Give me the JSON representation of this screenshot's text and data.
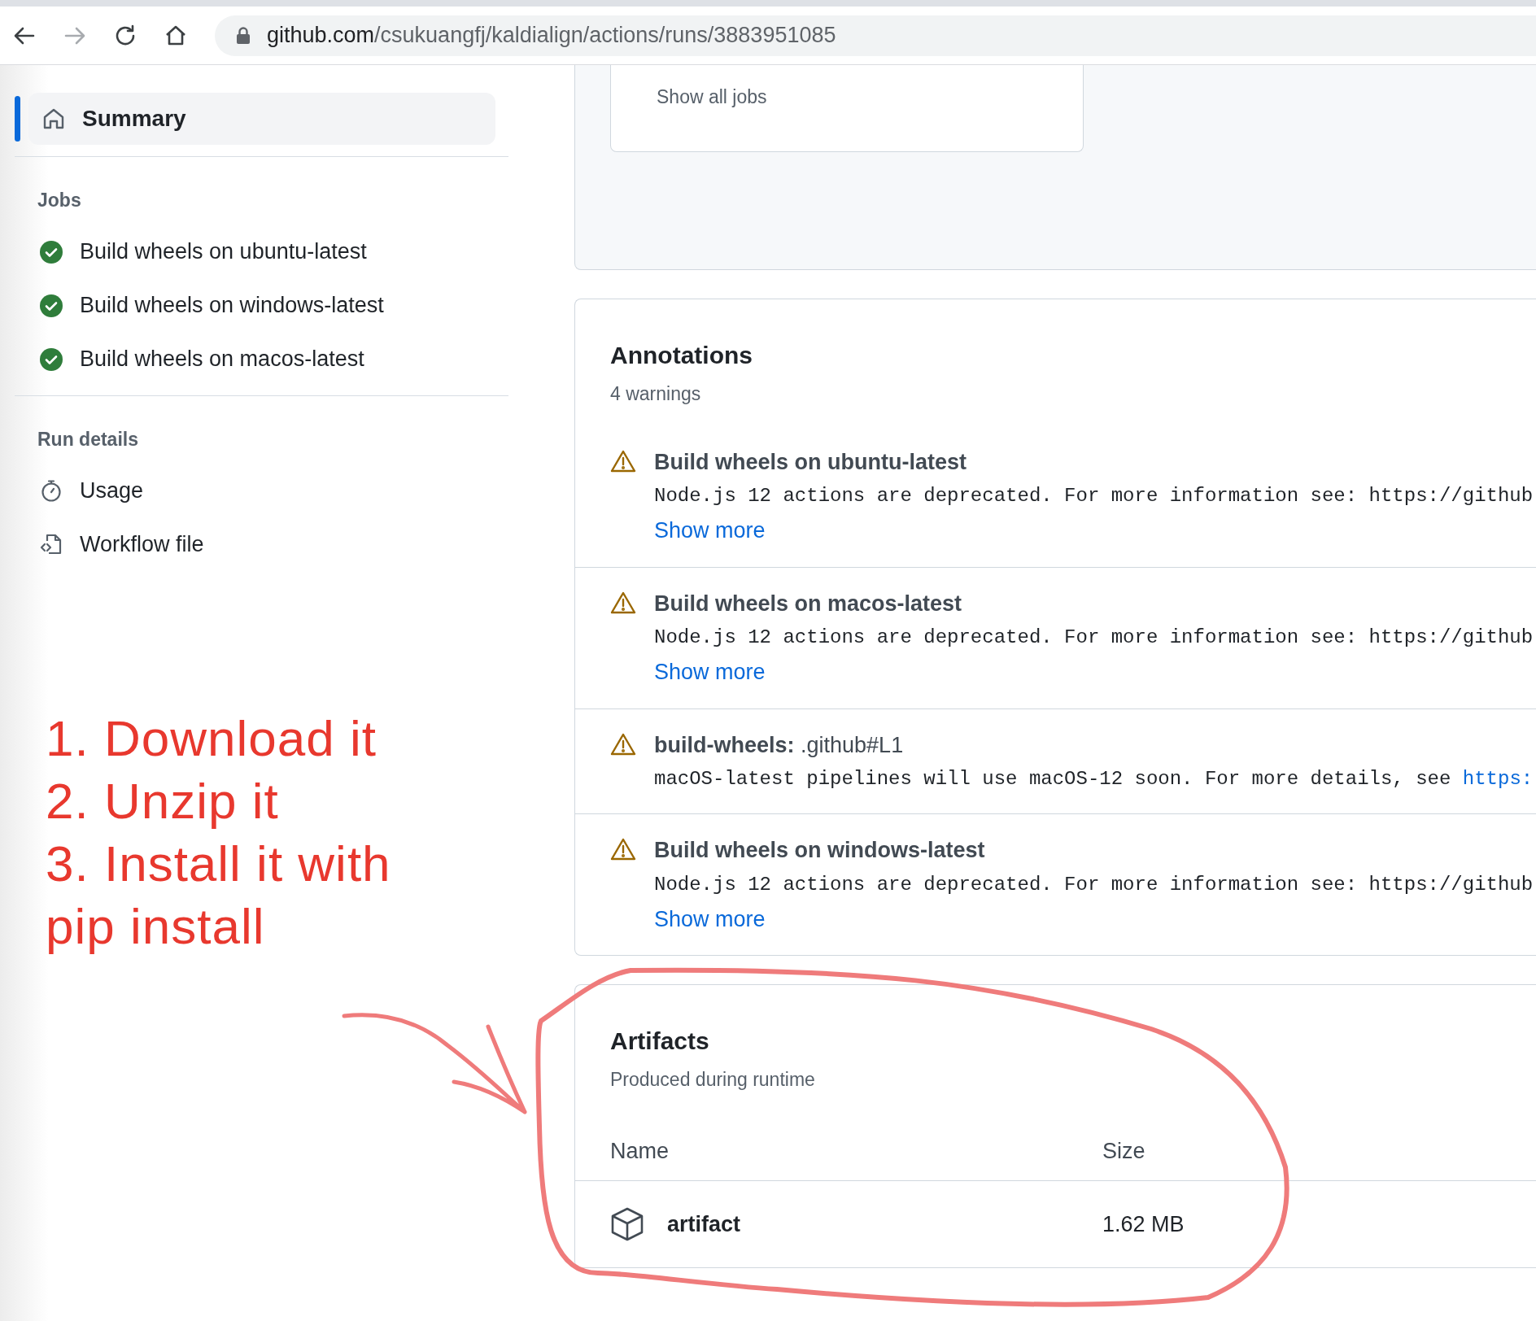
{
  "browser": {
    "forward_disabled": true,
    "url_host": "github.com",
    "url_path": "/csukuangfj/kaldialign/actions/runs/3883951085"
  },
  "sidebar": {
    "summary": {
      "label": "Summary",
      "selected": true
    },
    "sections": [
      {
        "title": "Jobs",
        "items": [
          {
            "kind": "job",
            "succeeded": true,
            "label": "Build wheels on ubuntu-latest"
          },
          {
            "kind": "job",
            "succeeded": true,
            "label": "Build wheels on windows-latest"
          },
          {
            "kind": "job",
            "succeeded": true,
            "label": "Build wheels on macos-latest"
          }
        ]
      },
      {
        "title": "Run details",
        "items": [
          {
            "kind": "usage",
            "label": "Usage"
          },
          {
            "kind": "workflow",
            "label": "Workflow file"
          }
        ]
      }
    ]
  },
  "jobs_card": {
    "link": "Show all jobs"
  },
  "annotations": {
    "title": "Annotations",
    "subtitle": "4 warnings",
    "items": [
      {
        "title": "Build wheels on ubuntu-latest",
        "message": "Node.js 12 actions are deprecated. For more information see: https://github",
        "more": "Show more"
      },
      {
        "title": "Build wheels on macos-latest",
        "message": "Node.js 12 actions are deprecated. For more information see: https://github",
        "more": "Show more"
      },
      {
        "title": "build-wheels:",
        "location": ".github#L1",
        "message": "macOS-latest pipelines will use macOS-12 soon. For more details, see ",
        "message_link": "https:"
      },
      {
        "title": "Build wheels on windows-latest",
        "message": "Node.js 12 actions are deprecated. For more information see: https://github",
        "more": "Show more"
      }
    ]
  },
  "artifacts": {
    "title": "Artifacts",
    "subtitle": "Produced during runtime",
    "columns": [
      "Name",
      "Size"
    ],
    "rows": [
      {
        "name": "artifact",
        "size": "1.62 MB"
      }
    ]
  },
  "note": {
    "lines": [
      "1. Download it",
      "2. Unzip it",
      "3. Install it with",
      "pip install"
    ]
  }
}
